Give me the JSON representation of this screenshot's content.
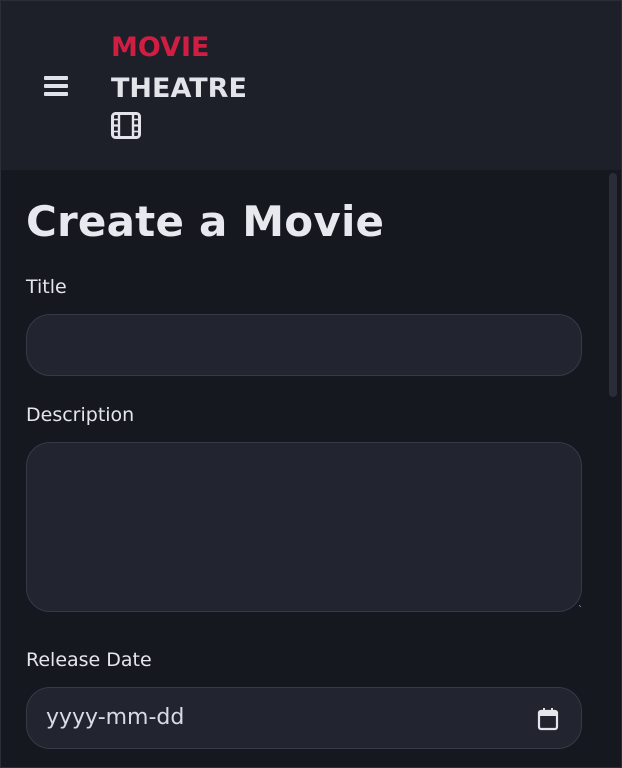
{
  "header": {
    "brand_line1": "MOVIE",
    "brand_line2": "THEATRE",
    "menu_icon": "hamburger-menu-icon",
    "logo_icon": "film-icon"
  },
  "form": {
    "title": "Create a Movie",
    "title_label": "Title",
    "title_value": "",
    "description_label": "Description",
    "description_value": "",
    "release_date_label": "Release Date",
    "release_date_placeholder": "yyyy-mm-dd",
    "calendar_icon": "calendar-icon"
  },
  "colors": {
    "accent": "#d21d43",
    "background": "#16181f",
    "header_background": "#1d1f29",
    "field_background": "#22242f"
  }
}
